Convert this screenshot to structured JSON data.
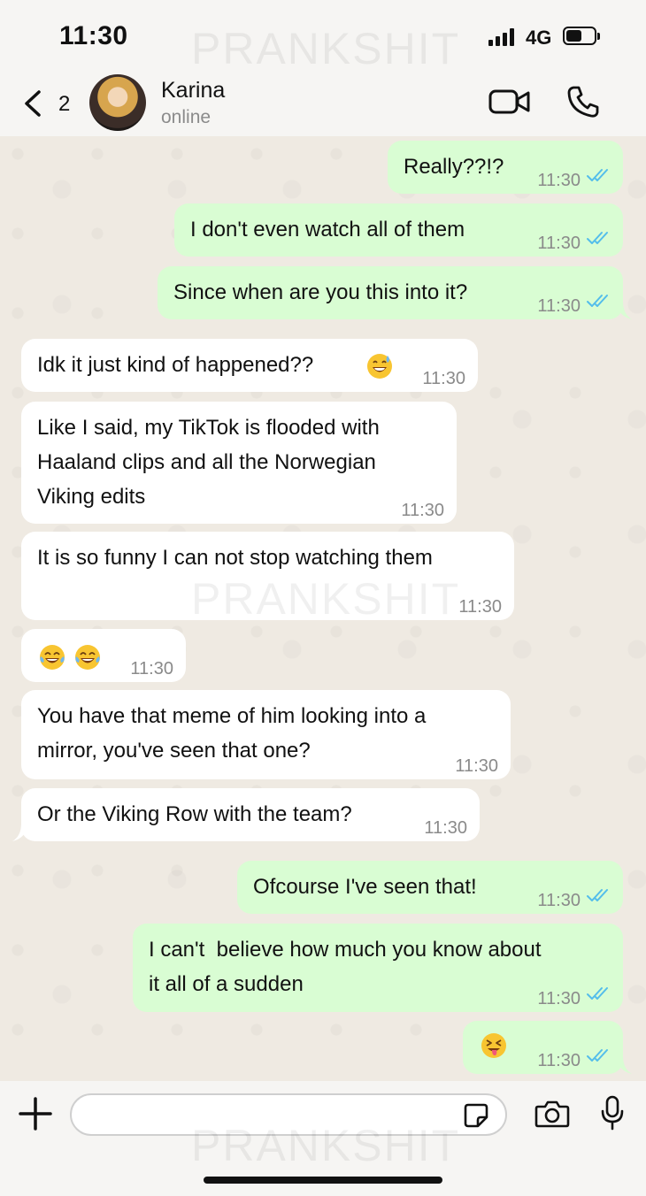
{
  "status_bar": {
    "time": "11:30",
    "network": "4G"
  },
  "watermark": "PRANKSHIT",
  "header": {
    "back_count": "2",
    "contact_name": "Karina",
    "contact_status": "online"
  },
  "messages": [
    {
      "dir": "out",
      "text": "Really??!?",
      "time": "11:30"
    },
    {
      "dir": "out",
      "text": "I don't even watch all of them",
      "time": "11:30"
    },
    {
      "dir": "out",
      "text": "Since when are you this into it?",
      "time": "11:30"
    },
    {
      "dir": "in",
      "text": "Idk it just kind of happened??",
      "emoji": "grinning-sweat",
      "time": "11:30"
    },
    {
      "dir": "in",
      "text": "Like I said, my TikTok is flooded with\nHaaland clips and all the Norwegian\nViking edits",
      "time": "11:30"
    },
    {
      "dir": "in",
      "text": "It is so funny I can not stop watching them",
      "time": "11:30"
    },
    {
      "dir": "in",
      "text": "",
      "emoji": "tears-of-joy x2",
      "time": "11:30"
    },
    {
      "dir": "in",
      "text": "You have that meme of him looking into a\nmirror, you've seen that one?",
      "time": "11:30"
    },
    {
      "dir": "in",
      "text": "Or the Viking Row with the team?",
      "time": "11:30"
    },
    {
      "dir": "out",
      "text": "Ofcourse I've seen that!",
      "time": "11:30"
    },
    {
      "dir": "out",
      "text": "I can't  believe how much you know about\nit all of a sudden",
      "time": "11:30"
    },
    {
      "dir": "out",
      "text": "",
      "emoji": "squinting-tongue",
      "time": "11:30"
    }
  ],
  "composer": {
    "placeholder": ""
  },
  "colors": {
    "outgoing": "#d9fdd3",
    "incoming": "#ffffff",
    "tick_blue": "#53bdeb"
  }
}
